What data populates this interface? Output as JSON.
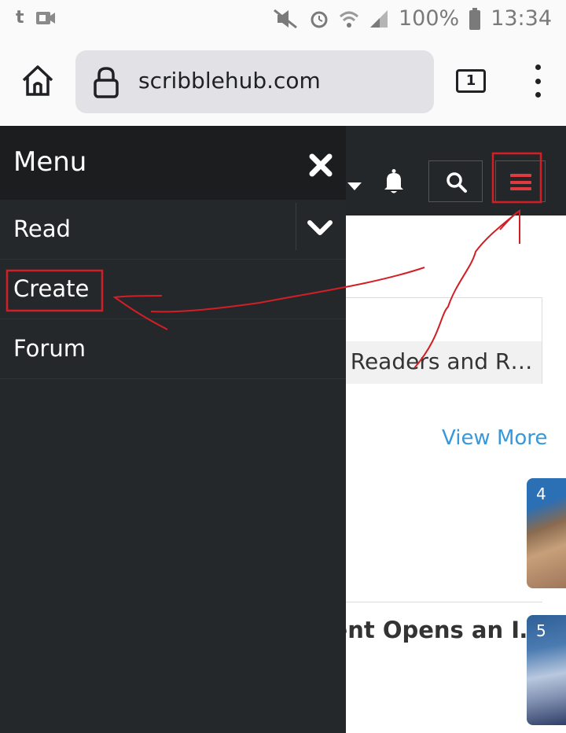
{
  "statusbar": {
    "battery": "100%",
    "time": "13:34",
    "app_icon_text": "t"
  },
  "browser": {
    "url": "scribblehub.com",
    "tab_count": "1"
  },
  "menu": {
    "title": "Menu",
    "items": [
      {
        "label": "Read"
      },
      {
        "label": "Create"
      },
      {
        "label": "Forum"
      }
    ]
  },
  "page": {
    "notice_text": "f Readers and R…",
    "view_more": "View More",
    "card1_rank": "4",
    "card2_rank": "5",
    "card2_title": "dent Opens an I…"
  },
  "colors": {
    "header_bg": "#24272a",
    "menu_bg": "#25282b",
    "accent_red": "#e03a3e",
    "link_blue": "#3a98d8",
    "annotation_red": "#d21f26"
  }
}
